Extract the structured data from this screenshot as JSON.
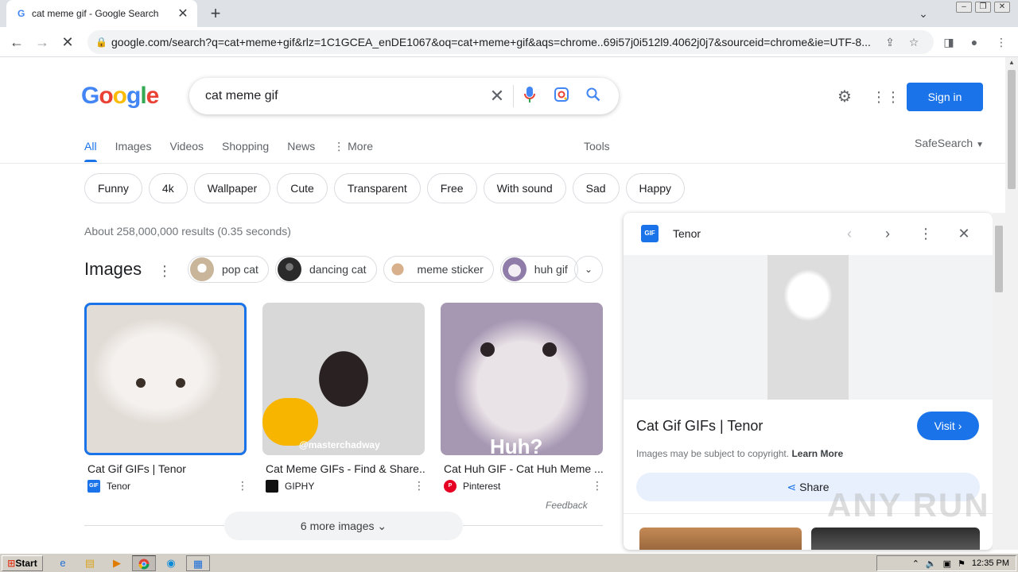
{
  "browser": {
    "tab_title": "cat meme gif - Google Search",
    "url": "google.com/search?q=cat+meme+gif&rlz=1C1GCEA_enDE1067&oq=cat+meme+gif&aqs=chrome..69i57j0i512l9.4062j0j7&sourceid=chrome&ie=UTF-8..."
  },
  "header": {
    "logo_letters": [
      "G",
      "o",
      "o",
      "g",
      "l",
      "e"
    ],
    "query": "cat meme gif",
    "sign_in": "Sign in"
  },
  "nav": {
    "tabs": [
      {
        "label": "All",
        "active": true
      },
      {
        "label": "Images"
      },
      {
        "label": "Videos"
      },
      {
        "label": "Shopping"
      },
      {
        "label": "News"
      },
      {
        "label": "More"
      }
    ],
    "tools": "Tools",
    "safesearch": "SafeSearch"
  },
  "chips": [
    "Funny",
    "4k",
    "Wallpaper",
    "Cute",
    "Transparent",
    "Free",
    "With sound",
    "Sad",
    "Happy"
  ],
  "stats": "About 258,000,000 results (0.35 seconds)",
  "images": {
    "heading": "Images",
    "related": [
      {
        "label": "pop cat",
        "color": "#c9b59a"
      },
      {
        "label": "dancing cat",
        "color": "#3a3a3a"
      },
      {
        "label": "meme sticker",
        "color": "#d9b08c"
      },
      {
        "label": "huh gif",
        "color": "#b9a8c8"
      }
    ],
    "results": [
      {
        "title": "Cat Gif GIFs | Tenor",
        "source": "Tenor",
        "fav_color": "#1a73e8",
        "fav_text": "GIF"
      },
      {
        "title": "Cat Meme GIFs - Find & Share...",
        "source": "GIPHY",
        "fav_color": "#111111",
        "fav_text": ""
      },
      {
        "title": "Cat Huh GIF - Cat Huh Meme ...",
        "source": "Pinterest",
        "fav_color": "#e60023",
        "fav_text": "P"
      }
    ],
    "overlay_texts": [
      "@masterchadway",
      "Huh?"
    ],
    "feedback": "Feedback",
    "more_images": "6 more images"
  },
  "panel": {
    "fav_text": "GIF",
    "source": "Tenor",
    "title": "Cat Gif GIFs | Tenor",
    "visit": "Visit",
    "copyright": "Images may be subject to copyright.",
    "learn_more": "Learn More",
    "share": "Share"
  },
  "watermark": "ANY RUN",
  "taskbar": {
    "start": "Start",
    "clock": "12:35 PM"
  }
}
